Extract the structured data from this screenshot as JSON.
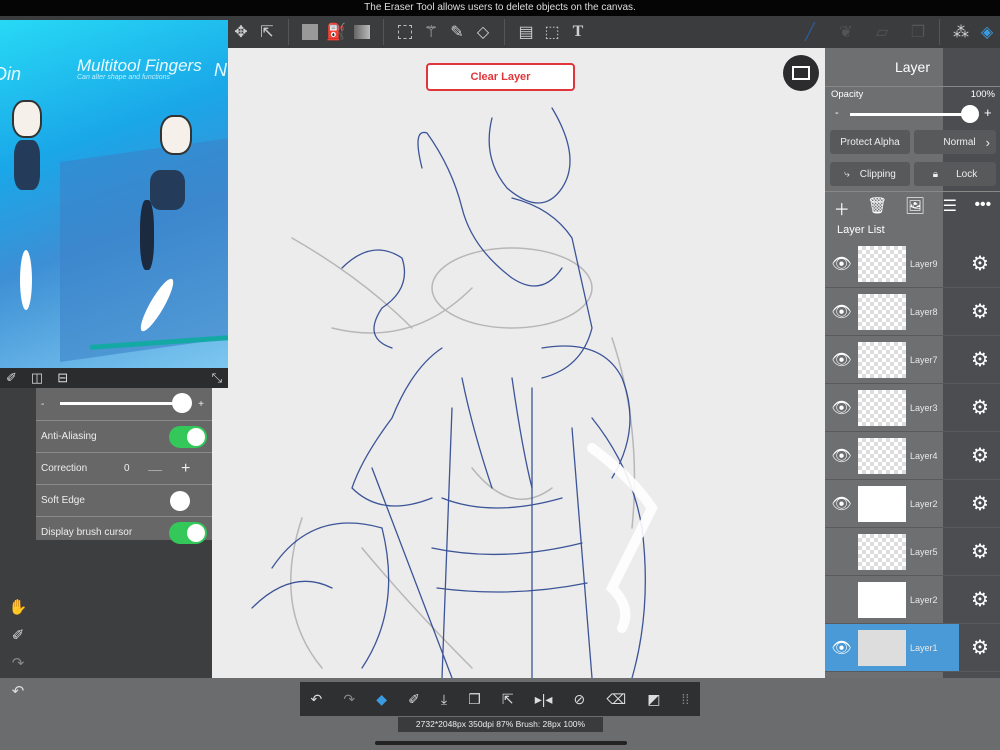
{
  "tooltip": "The Eraser Tool allows users to delete objects on the canvas.",
  "toolbar": {
    "icons": [
      "move-icon",
      "transform-icon",
      "fill-color-icon",
      "bucket-icon",
      "gradient-icon",
      "select-rect-icon",
      "magic-wand-icon",
      "select-pen-icon",
      "select-eraser-icon",
      "panel-layout-icon",
      "operation-icon",
      "text-icon",
      "pen-icon",
      "brush-icon",
      "eraser-icon",
      "layer-fill-icon",
      "materials-icon",
      "layers-icon"
    ],
    "text_glyph": "T"
  },
  "canvas": {
    "clear_layer": "Clear Layer"
  },
  "reference": {
    "title": "Multitool Fingers",
    "subtitle": "Can alter shape and functions",
    "left_text": "Din",
    "right_text": "N"
  },
  "brush_settings": {
    "anti_aliasing_label": "Anti-Aliasing",
    "anti_aliasing": true,
    "correction_label": "Correction",
    "correction_value": "0",
    "soft_edge_label": "Soft Edge",
    "soft_edge": false,
    "display_cursor_label": "Display brush cursor",
    "display_cursor": true,
    "size_level": 1.0,
    "minus": "-",
    "plus": "+"
  },
  "layer_panel": {
    "title": "Layer",
    "opacity_label": "Opacity",
    "opacity_value": "100%",
    "protect_alpha": "Protect Alpha",
    "blend_mode": "Normal",
    "clipping": "Clipping",
    "lock": "Lock",
    "list_label": "Layer List",
    "layers": [
      {
        "name": "Layer9",
        "visible": true,
        "selected": false
      },
      {
        "name": "Layer8",
        "visible": true,
        "selected": false
      },
      {
        "name": "Layer7",
        "visible": true,
        "selected": false
      },
      {
        "name": "Layer3",
        "visible": true,
        "selected": false
      },
      {
        "name": "Layer4",
        "visible": true,
        "selected": false
      },
      {
        "name": "Layer2",
        "visible": true,
        "selected": false
      },
      {
        "name": "Layer5",
        "visible": false,
        "selected": false
      },
      {
        "name": "Layer2",
        "visible": false,
        "selected": false
      },
      {
        "name": "Layer1",
        "visible": true,
        "selected": true
      }
    ]
  },
  "status": "2732*2048px 350dpi 87% Brush: 28px 100%",
  "colors": {
    "accent": "#4a9ad8",
    "toggle_on": "#34c759",
    "clear_layer": "#e0353a",
    "sketch": "#1e3a8a"
  }
}
